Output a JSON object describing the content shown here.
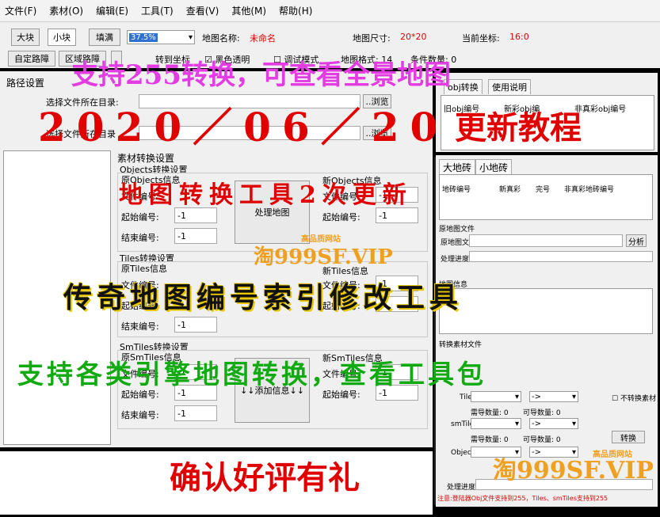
{
  "menu": [
    "文件(F)",
    "素材(O)",
    "编辑(E)",
    "工具(T)",
    "查看(V)",
    "其他(M)",
    "帮助(H)"
  ],
  "toolbar": {
    "big_block": "大块",
    "small_block": "小块",
    "fill": "填满",
    "zoom": "37.5%",
    "map_name_label": "地图名称:",
    "map_name_value": "未命名",
    "map_size_label": "地图尺寸:",
    "map_size_value": "20*20",
    "coord_label": "当前坐标:",
    "coord_value": "16:0",
    "custom_path": "自定路障",
    "area_path": "区域路障",
    "goto_coord": "转到坐标",
    "black_transparent": "黑色透明",
    "debug_mode": "调试模式",
    "map_format": "地图格式: 14",
    "material_count": "条件数量: 0"
  },
  "path_settings": {
    "title": "路径设置",
    "select_dir_label": "选择文件所在目录:",
    "browse": "..浏览",
    "select_dir_label2": "选择文件所在目录"
  },
  "convert": {
    "title": "素材转换设置",
    "objects_title": "Objects转换设置",
    "orig_objects": "原Objects信息",
    "new_objects": "新Objects信息",
    "file_no": "文件编号:",
    "start_no": "起始编号:",
    "end_no": "结束编号:",
    "obj_start": "-1",
    "obj_end": "-1",
    "obj_new_file": "-1",
    "obj_new_start": "-1",
    "process_map": "处理地图",
    "tiles_title": "Tiles转换设置",
    "orig_tiles": "原Tiles信息",
    "new_tiles": "新Tiles信息",
    "tiles_end": "-1",
    "tiles_new_file": "-1",
    "tiles_new_start": "-1",
    "smtiles_title": "SmTiles转换设置",
    "orig_smtiles": "原SmTiles信息",
    "new_smtiles": "新SmTiles信息",
    "sm_file": "-1",
    "sm_start": "-1",
    "sm_end": "-1",
    "sm_new_file": "-1",
    "sm_new_start": "-1",
    "add_info": "↓↓添加信息↓↓"
  },
  "right_top": {
    "tab1": "obj转换",
    "tab2": "使用说明",
    "col1": "旧obj编号",
    "col2": "新彩obj编",
    "col3": "非真彩obj编号"
  },
  "right_panel": {
    "tab_big": "大地砖",
    "tab_small": "小地砖",
    "col1": "地砖编号",
    "col2": "新真彩",
    "col3": "完号",
    "col4": "非真彩地砖编号",
    "orig_map_file": "原地图文件",
    "orig_map_label": "原地图文件:",
    "analyze": "分析",
    "progress": "处理进度:",
    "info_title": "地图信息",
    "convert_title": "转换素材文件",
    "tiles_label": "Tiles:",
    "smtiles_label": "smTiles:",
    "objects_label": "Objects:",
    "need_count": "需导数量: 0",
    "available_count": "可导数量: 0",
    "no_convert": "不转换素材",
    "convert_btn": "转换",
    "progress2": "处理进度:",
    "note": "注意:登陆器Obj文件支持到255，Tiles、smTiles支持到255"
  },
  "overlay": {
    "line1": "支持255转换，可查看全景地图",
    "date": "2020／06／20",
    "tutorial": "更新教程",
    "second_update": "地图转换工具2次更新",
    "watermark": "淘999SF.VIP",
    "watermark_tag": "高品质网站",
    "legend": "传奇地图编号索引修改工具",
    "support": "支持各类引擎地图转换，查看工具包",
    "confirm": "确认好评有礼"
  }
}
